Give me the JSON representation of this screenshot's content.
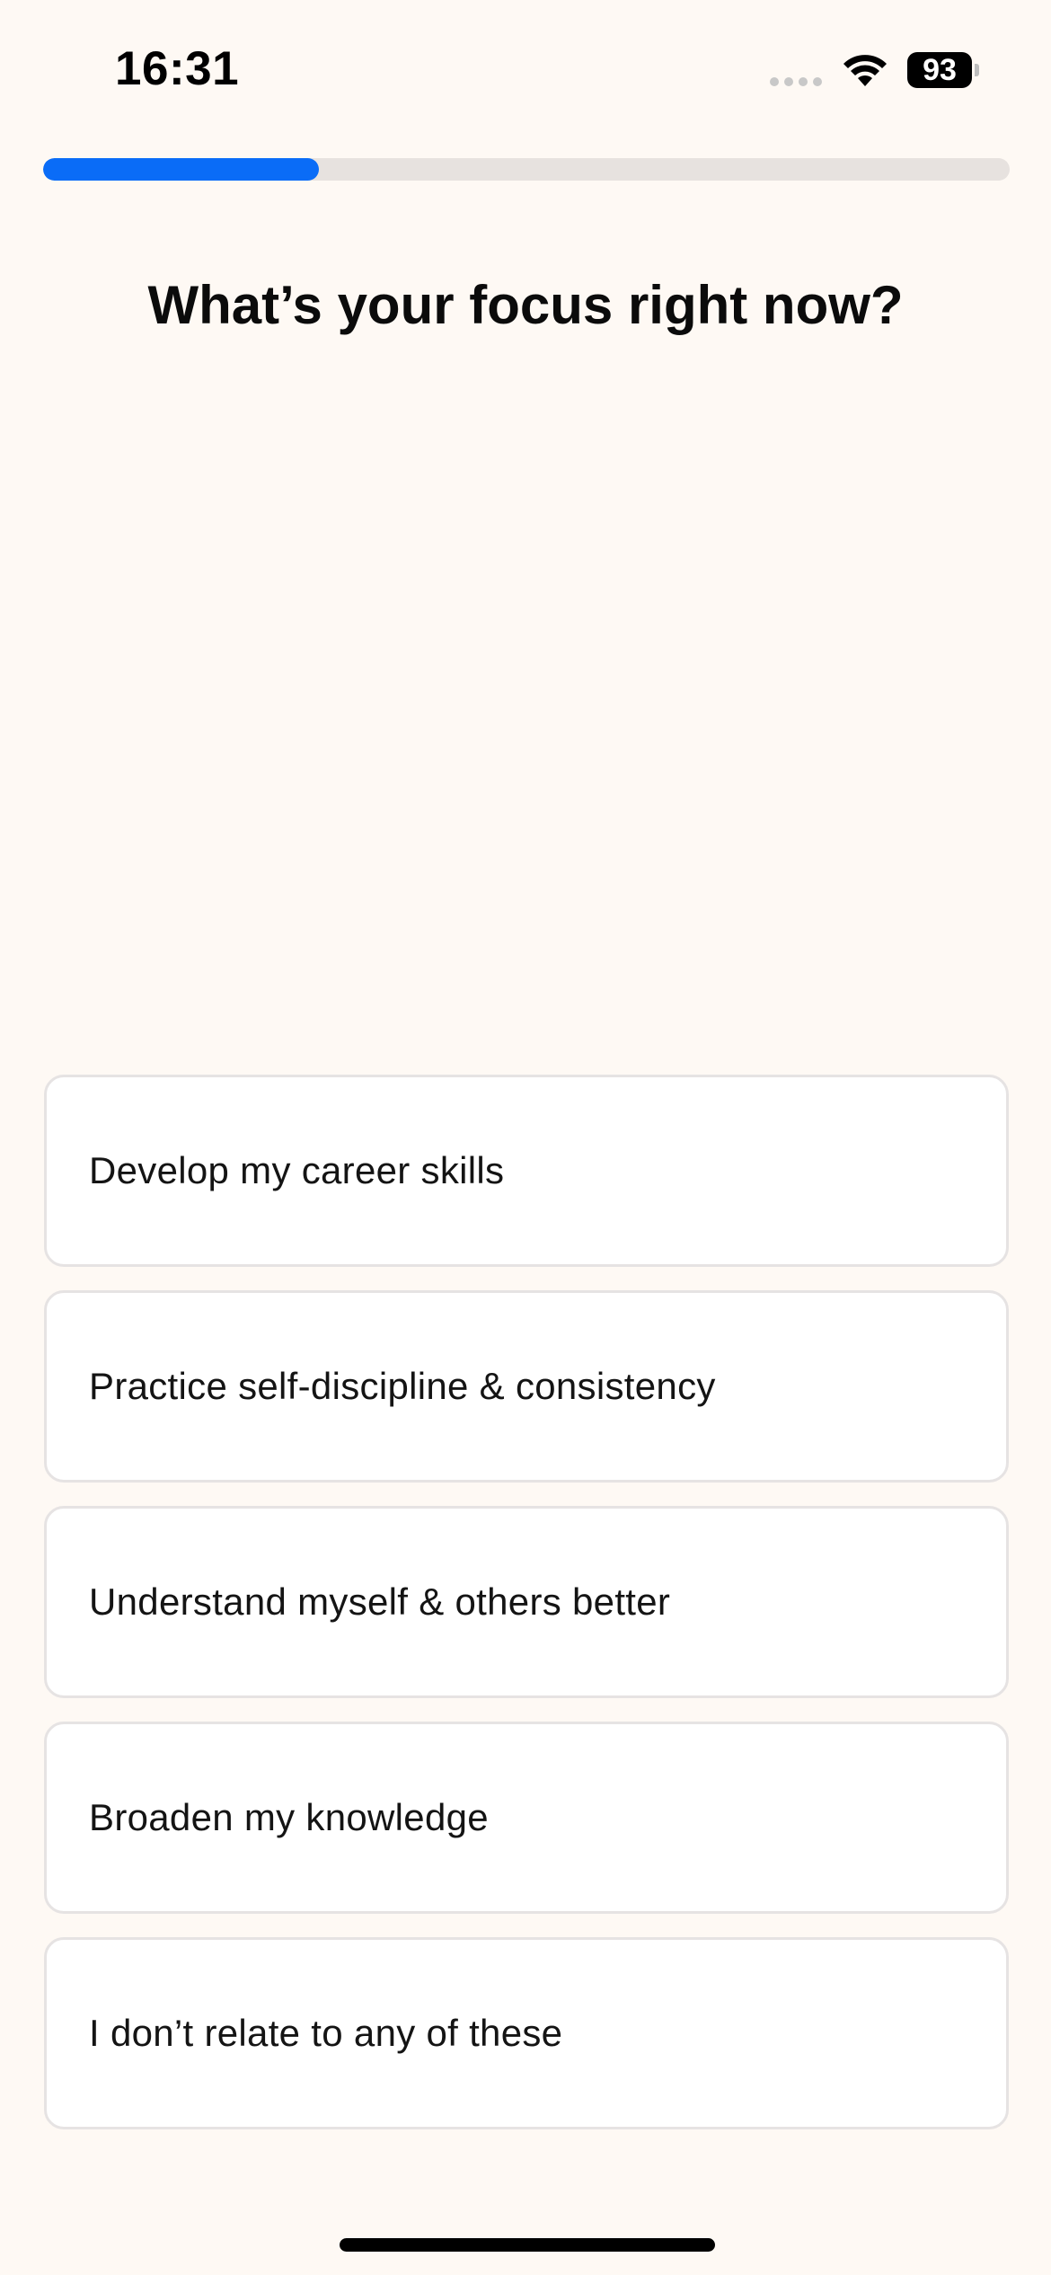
{
  "status_bar": {
    "time": "16:31",
    "battery_level": "93",
    "signal_icon": "cellular-dots-icon",
    "wifi_icon": "wifi-icon",
    "battery_icon": "battery-icon"
  },
  "progress": {
    "fraction": 0.285,
    "fill_color": "#0a6cf7",
    "track_color": "#e7e2df"
  },
  "question": {
    "title": "What’s your focus right now?"
  },
  "options": [
    {
      "label": "Develop my career skills"
    },
    {
      "label": "Practice self-discipline & consistency"
    },
    {
      "label": "Understand myself & others better"
    },
    {
      "label": "Broaden my knowledge"
    },
    {
      "label": "I don’t relate to any of these"
    }
  ],
  "colors": {
    "background": "#fef9f4",
    "card": "#ffffff",
    "card_border": "#e6e3e3",
    "accent": "#0a6cf7"
  }
}
